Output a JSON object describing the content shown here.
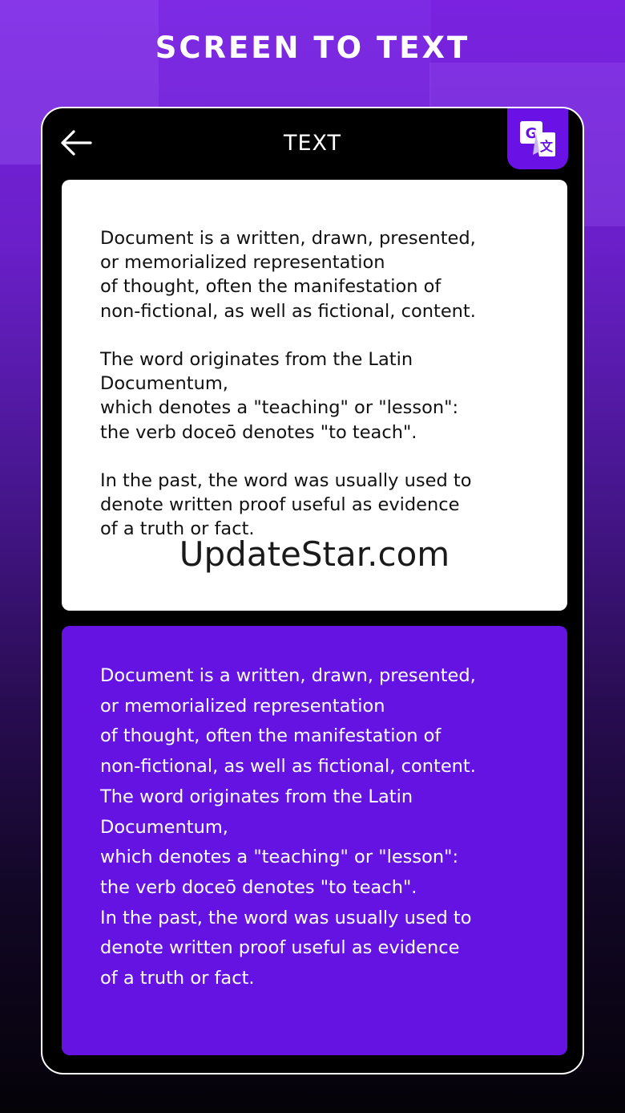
{
  "banner": {
    "headline": "SCREEN TO TEXT"
  },
  "app_bar": {
    "title": "TEXT",
    "back_icon": "arrow-left-icon",
    "translate_icon": "google-translate-icon"
  },
  "source_card": {
    "text": "Document is a written, drawn, presented,\nor memorialized representation\nof thought, often the manifestation of\nnon-fictional, as well as fictional, content.\n\nThe word originates from the Latin\nDocumentum,\nwhich denotes a \"teaching\" or \"lesson\":\nthe verb doceō denotes \"to teach\".\n\nIn the past, the word was usually used to\ndenote written proof useful as evidence\nof a truth or fact.",
    "watermark": "UpdateStar.com"
  },
  "result_card": {
    "text": "Document is a written, drawn, presented,\nor memorialized representation\nof thought, often the manifestation of\nnon-fictional, as well as fictional, content.\nThe word originates from the Latin\nDocumentum,\nwhich denotes a \"teaching\" or \"lesson\":\nthe verb doceō denotes \"to teach\".\nIn the past, the word was usually used to\ndenote written proof useful as evidence\nof a truth or fact."
  },
  "colors": {
    "accent": "#6413e3",
    "background_top": "#7a22e0",
    "background_bottom": "#050208",
    "card_light": "#ffffff",
    "frame": "#000000"
  }
}
